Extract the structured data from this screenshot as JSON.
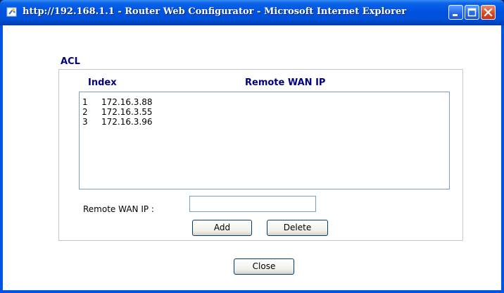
{
  "window": {
    "title": "http://192.168.1.1 - Router Web Configurator - Microsoft Internet Explorer",
    "controls": {
      "minimize_icon": "minimize-icon",
      "maximize_icon": "maximize-icon",
      "close_icon": "close-icon"
    }
  },
  "acl": {
    "title": "ACL",
    "columns": {
      "index": "Index",
      "remote_wan_ip": "Remote WAN IP"
    },
    "entries": [
      {
        "index": "1",
        "ip": "172.16.3.88"
      },
      {
        "index": "2",
        "ip": "172.16.3.55"
      },
      {
        "index": "3",
        "ip": "172.16.3.96"
      }
    ],
    "input_label": "Remote WAN IP :",
    "input_value": "",
    "add_label": "Add",
    "delete_label": "Delete"
  },
  "close_label": "Close",
  "colors": {
    "title_bar": "#0054e3",
    "heading_text": "#000080"
  }
}
